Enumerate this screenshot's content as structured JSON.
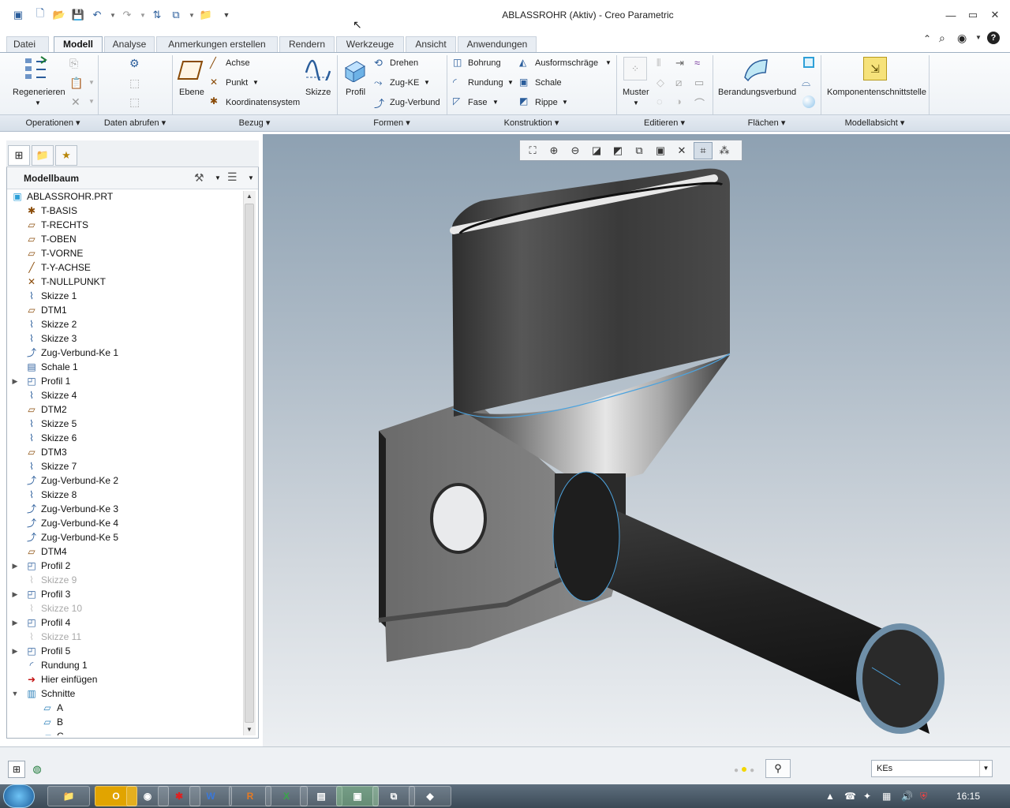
{
  "window": {
    "title": "ABLASSROHR (Aktiv) - Creo Parametric"
  },
  "tabs": [
    "Datei",
    "Modell",
    "Analyse",
    "Anmerkungen erstellen",
    "Rendern",
    "Werkzeuge",
    "Ansicht",
    "Anwendungen"
  ],
  "ribbon": {
    "regenerieren": "Regenerieren",
    "ebene": "Ebene",
    "achse": "Achse",
    "punkt": "Punkt",
    "koordinatensystem": "Koordinatensystem",
    "skizze": "Skizze",
    "profil": "Profil",
    "drehen": "Drehen",
    "zug_ke": "Zug-KE",
    "zug_verbund": "Zug-Verbund",
    "bohrung": "Bohrung",
    "rundung": "Rundung",
    "fase": "Fase",
    "ausformschraege": "Ausformschräge",
    "schale": "Schale",
    "rippe": "Rippe",
    "muster": "Muster",
    "berandungsverbund": "Berandungsverbund",
    "komponentenschnittstelle": "Komponentenschnittstelle"
  },
  "groups": [
    "Operationen",
    "Daten abrufen",
    "Bezug",
    "Formen",
    "Konstruktion",
    "Editieren",
    "Flächen",
    "Modellabsicht"
  ],
  "model_tree": {
    "header": "Modellbaum",
    "items": [
      {
        "label": "ABLASSROHR.PRT",
        "icon": "part-icon",
        "dim": false,
        "expand": ""
      },
      {
        "label": "T-BASIS",
        "icon": "csys-icon",
        "dim": false,
        "expand": ""
      },
      {
        "label": "T-RECHTS",
        "icon": "datum-plane-icon",
        "dim": false,
        "expand": ""
      },
      {
        "label": "T-OBEN",
        "icon": "datum-plane-icon",
        "dim": false,
        "expand": ""
      },
      {
        "label": "T-VORNE",
        "icon": "datum-plane-icon",
        "dim": false,
        "expand": ""
      },
      {
        "label": "T-Y-ACHSE",
        "icon": "axis-icon",
        "dim": false,
        "expand": ""
      },
      {
        "label": "T-NULLPUNKT",
        "icon": "point-icon",
        "dim": false,
        "expand": ""
      },
      {
        "label": "Skizze 1",
        "icon": "sketch-icon",
        "dim": false,
        "expand": ""
      },
      {
        "label": "DTM1",
        "icon": "datum-plane-icon",
        "dim": false,
        "expand": ""
      },
      {
        "label": "Skizze 2",
        "icon": "sketch-icon",
        "dim": false,
        "expand": ""
      },
      {
        "label": "Skizze 3",
        "icon": "sketch-icon",
        "dim": false,
        "expand": ""
      },
      {
        "label": "Zug-Verbund-Ke 1",
        "icon": "blend-icon",
        "dim": false,
        "expand": ""
      },
      {
        "label": "Schale 1",
        "icon": "shell-icon",
        "dim": false,
        "expand": ""
      },
      {
        "label": "Profil 1",
        "icon": "extrude-icon",
        "dim": false,
        "expand": "▶"
      },
      {
        "label": "Skizze 4",
        "icon": "sketch-icon",
        "dim": false,
        "expand": ""
      },
      {
        "label": "DTM2",
        "icon": "datum-plane-icon",
        "dim": false,
        "expand": ""
      },
      {
        "label": "Skizze 5",
        "icon": "sketch-icon",
        "dim": false,
        "expand": ""
      },
      {
        "label": "Skizze 6",
        "icon": "sketch-icon",
        "dim": false,
        "expand": ""
      },
      {
        "label": "DTM3",
        "icon": "datum-plane-icon",
        "dim": false,
        "expand": ""
      },
      {
        "label": "Skizze 7",
        "icon": "sketch-icon",
        "dim": false,
        "expand": ""
      },
      {
        "label": "Zug-Verbund-Ke 2",
        "icon": "blend-icon",
        "dim": false,
        "expand": ""
      },
      {
        "label": "Skizze 8",
        "icon": "sketch-icon",
        "dim": false,
        "expand": ""
      },
      {
        "label": "Zug-Verbund-Ke 3",
        "icon": "blend-icon",
        "dim": false,
        "expand": ""
      },
      {
        "label": "Zug-Verbund-Ke 4",
        "icon": "blend-icon",
        "dim": false,
        "expand": ""
      },
      {
        "label": "Zug-Verbund-Ke 5",
        "icon": "blend-icon",
        "dim": false,
        "expand": ""
      },
      {
        "label": "DTM4",
        "icon": "datum-plane-icon",
        "dim": false,
        "expand": ""
      },
      {
        "label": "Profil 2",
        "icon": "extrude-icon",
        "dim": false,
        "expand": "▶"
      },
      {
        "label": "Skizze 9",
        "icon": "sketch-icon",
        "dim": true,
        "expand": ""
      },
      {
        "label": "Profil 3",
        "icon": "extrude-icon",
        "dim": false,
        "expand": "▶"
      },
      {
        "label": "Skizze 10",
        "icon": "sketch-icon",
        "dim": true,
        "expand": ""
      },
      {
        "label": "Profil 4",
        "icon": "extrude-icon",
        "dim": false,
        "expand": "▶"
      },
      {
        "label": "Skizze 11",
        "icon": "sketch-icon",
        "dim": true,
        "expand": ""
      },
      {
        "label": "Profil 5",
        "icon": "extrude-icon",
        "dim": false,
        "expand": "▶"
      },
      {
        "label": "Rundung 1",
        "icon": "round-icon",
        "dim": false,
        "expand": ""
      },
      {
        "label": "Hier einfügen",
        "icon": "insert-arrow-icon",
        "dim": false,
        "expand": ""
      },
      {
        "label": "Schnitte",
        "icon": "sections-folder-icon",
        "dim": false,
        "expand": "▼"
      },
      {
        "label": "A",
        "icon": "section-icon",
        "dim": false,
        "expand": "",
        "indent": true
      },
      {
        "label": "B",
        "icon": "section-icon",
        "dim": false,
        "expand": "",
        "indent": true
      },
      {
        "label": "C",
        "icon": "section-icon",
        "dim": false,
        "expand": "",
        "indent": true
      }
    ]
  },
  "status": {
    "filter_value": "KEs"
  },
  "taskbar": {
    "clock": "16:15"
  },
  "colors": {
    "accent": "#2a5d9b",
    "viewport_top": "#8ea1b2",
    "viewport_bottom": "#eceff2"
  }
}
